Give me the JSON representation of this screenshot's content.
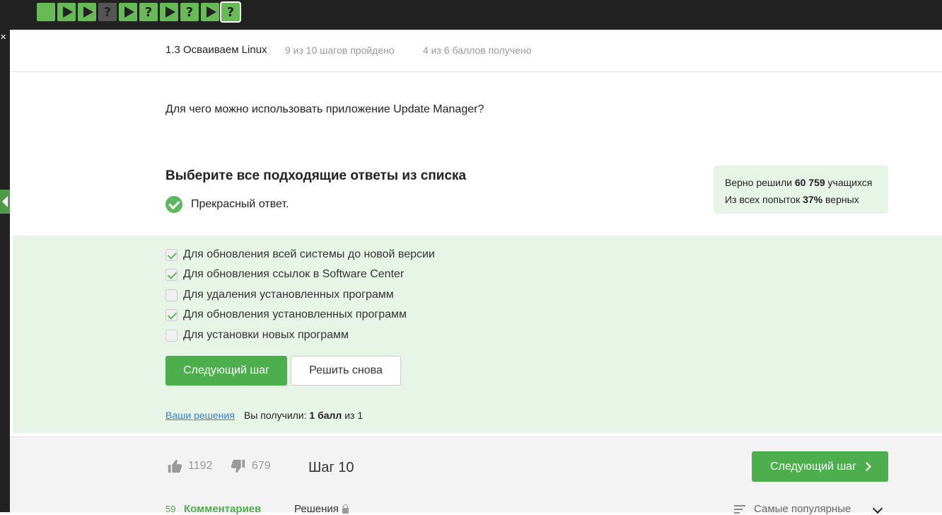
{
  "steps_nav": [
    {
      "kind": "green-solved",
      "label": ""
    },
    {
      "kind": "green-play",
      "label": ""
    },
    {
      "kind": "green-play",
      "label": ""
    },
    {
      "kind": "grey-question",
      "label": "?"
    },
    {
      "kind": "green-play",
      "label": ""
    },
    {
      "kind": "green-question",
      "label": "?"
    },
    {
      "kind": "green-play",
      "label": ""
    },
    {
      "kind": "green-question",
      "label": "?"
    },
    {
      "kind": "green-play",
      "label": ""
    },
    {
      "kind": "green-question-current",
      "label": "?"
    }
  ],
  "header": {
    "lesson_title": "1.3 Осваиваем Linux",
    "steps_progress": "9 из 10 шагов пройдено",
    "score_progress": "4 из 6 баллов  получено"
  },
  "question": "Для чего можно использовать приложение Update Manager?",
  "task": {
    "title": "Выберите все подходящие ответы из списка",
    "verdict": "Прекрасный ответ."
  },
  "stats": {
    "solved_prefix": "Верно решили ",
    "solved_count": "60 759",
    "solved_suffix": " учащихся",
    "attempts_prefix": "Из всех попыток ",
    "attempts_percent": "37%",
    "attempts_suffix": " верных"
  },
  "options": [
    {
      "label": "Для обновления всей системы до новой версии",
      "checked": true
    },
    {
      "label": "Для обновления ссылок в Software Center",
      "checked": true
    },
    {
      "label": "Для удаления установленных программ",
      "checked": false
    },
    {
      "label": "Для обновления установленных программ",
      "checked": true
    },
    {
      "label": "Для установки новых программ",
      "checked": false
    }
  ],
  "buttons": {
    "next": "Следующий шаг",
    "retry": "Решить снова"
  },
  "result": {
    "solutions_link": "Ваши решения",
    "got_prefix": "Вы получили: ",
    "got_points": "1 балл",
    "got_suffix": " из 1"
  },
  "footer": {
    "likes": "1192",
    "dislikes": "679",
    "step_label": "Шаг 10",
    "next_button": "Следующий шаг",
    "comments_count": "59",
    "comments_label": "Комментариев",
    "solutions_tab": "Решения",
    "sort_label": "Самые популярные"
  },
  "colors": {
    "accent": "#4cae4c",
    "success_bg": "#e6f5e6",
    "topbar": "#222222"
  }
}
